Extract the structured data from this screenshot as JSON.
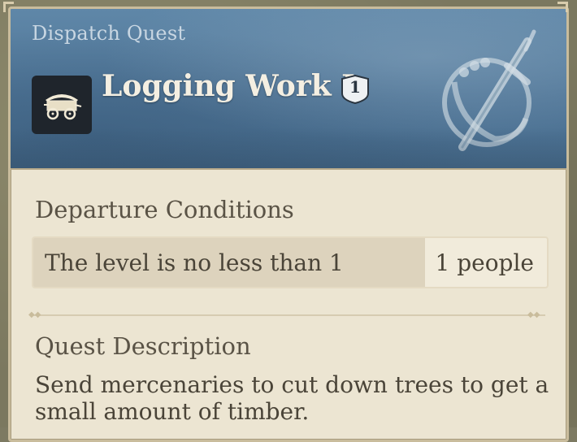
{
  "quest": {
    "type_label": "Dispatch Quest",
    "title": "Logging Work I",
    "level": "1",
    "icon": "wagon-icon",
    "emblem": "crossed-swords-emblem-icon"
  },
  "departure": {
    "heading": "Departure Conditions",
    "condition": "The level is no less than 1",
    "count": "1 people"
  },
  "description": {
    "heading": "Quest Description",
    "text": "Send mercenaries to cut down trees to get a small amount of timber."
  },
  "colors": {
    "header_blue": "#4f7597",
    "panel_bg": "#ece5d2",
    "heading_text": "#5a5346",
    "body_text": "#4a4438"
  }
}
